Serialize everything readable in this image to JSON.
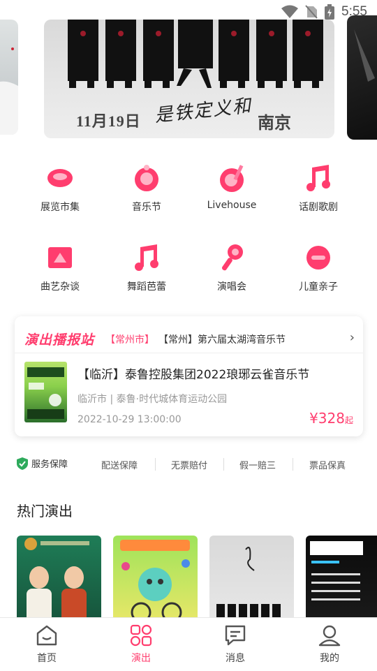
{
  "status_bar": {
    "time": "5:55",
    "icons": [
      "wifi-icon",
      "no-sim-icon",
      "battery-charging-icon"
    ]
  },
  "banner": {
    "date_text": "11月19日",
    "city_text": "南京",
    "script_text": "是铁定义和"
  },
  "categories": [
    {
      "label": "展览市集",
      "icon": "exhibition-icon"
    },
    {
      "label": "音乐节",
      "icon": "music-festival-icon"
    },
    {
      "label": "Livehouse",
      "icon": "livehouse-icon"
    },
    {
      "label": "话剧歌剧",
      "icon": "drama-opera-icon"
    },
    {
      "label": "曲艺杂谈",
      "icon": "folk-art-icon"
    },
    {
      "label": "舞蹈芭蕾",
      "icon": "dance-ballet-icon"
    },
    {
      "label": "演唱会",
      "icon": "concert-icon"
    },
    {
      "label": "儿童亲子",
      "icon": "kids-family-icon"
    }
  ],
  "broadcast": {
    "logo": "演出播报站",
    "tag": "【常州市】",
    "headline": "【常州】第六届太湖湾音乐节",
    "item": {
      "title": "【临沂】泰鲁控股集团2022琅琊云雀音乐节",
      "venue": "临沂市 | 泰鲁·时代城体育运动公园",
      "time": "2022-10-29 13:00:00",
      "price_symbol": "¥",
      "price": "328",
      "price_suffix": "起"
    }
  },
  "service": {
    "main": "服务保障",
    "items": [
      "配送保障",
      "无票赔付",
      "假一赔三",
      "票品保真"
    ]
  },
  "hot": {
    "title": "热门演出",
    "cards": [
      {
        "theme": "crosstalk",
        "colors": [
          "#1f7d57",
          "#154f38"
        ]
      },
      {
        "theme": "kids-carnival",
        "colors": [
          "#9ee35a",
          "#f2e86a"
        ]
      },
      {
        "theme": "gray-poster",
        "colors": [
          "#d9d9d9",
          "#e9e9e9"
        ]
      },
      {
        "theme": "hip-hop-poster",
        "colors": [
          "#0b0b0b",
          "#1c1c1c"
        ]
      }
    ]
  },
  "nav": {
    "items": [
      {
        "label": "首页",
        "icon": "home-icon",
        "active": false
      },
      {
        "label": "演出",
        "icon": "shows-icon",
        "active": true
      },
      {
        "label": "消息",
        "icon": "message-icon",
        "active": false
      },
      {
        "label": "我的",
        "icon": "profile-icon",
        "active": false
      }
    ]
  },
  "colors": {
    "accent": "#ff3d6e",
    "accent_light": "#ffb3c6"
  }
}
